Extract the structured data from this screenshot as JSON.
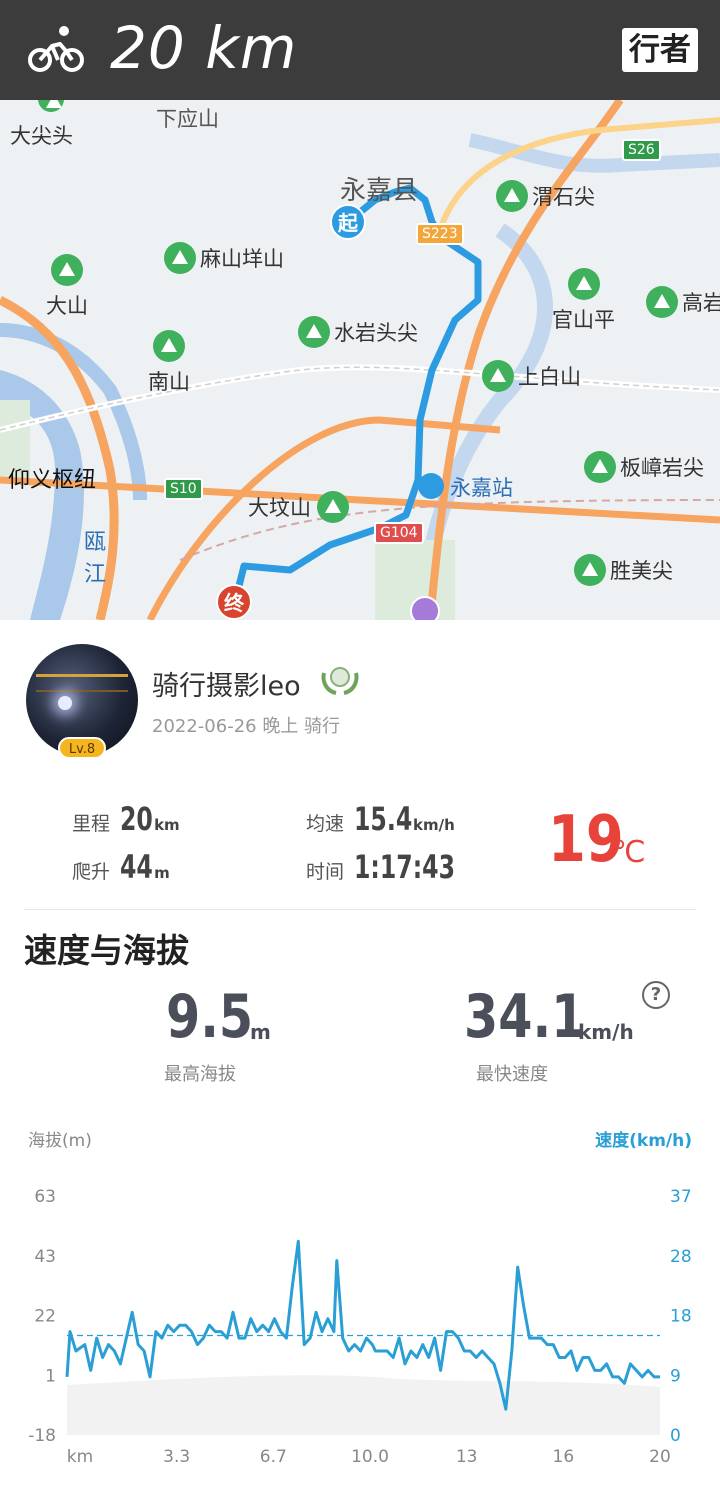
{
  "header": {
    "distance": "20 km",
    "brand": "行者"
  },
  "map": {
    "pois": [
      "大尖头",
      "麻山垟山",
      "大山",
      "水岩头尖",
      "南山",
      "大坟山",
      "渭石尖",
      "官山平",
      "高岩",
      "上白山",
      "板嶂岩尖",
      "胜美尖"
    ],
    "labels": [
      "下应山",
      "永嘉县",
      "仰义枢纽",
      "瓯",
      "江",
      "永嘉站"
    ],
    "roads": [
      "S26",
      "S223",
      "S10",
      "G104"
    ],
    "start_label": "起",
    "end_label": "终"
  },
  "profile": {
    "username": "骑行摄影leo",
    "level": "Lv.8",
    "date": "2022-06-26 晚上 骑行"
  },
  "stats": {
    "distance_label": "里程",
    "distance_value": "20",
    "distance_unit": "km",
    "climb_label": "爬升",
    "climb_value": "44",
    "climb_unit": "m",
    "avg_label": "均速",
    "avg_value": "15.4",
    "avg_unit": "km/h",
    "time_label": "时间",
    "time_value": "1:17:43",
    "temp_value": "19",
    "temp_unit": "℃"
  },
  "section": {
    "title": "速度与海拔",
    "max_alt_value": "9.5",
    "max_alt_unit": "m",
    "max_alt_label": "最高海拔",
    "max_speed_value": "34.1",
    "max_speed_unit": "km/h",
    "max_speed_label": "最快速度",
    "help": "?"
  },
  "colors": {
    "speed_line": "#2a9fd6",
    "route": "#2c9be2",
    "temp": "#e8433a",
    "poi": "#3fb05c"
  },
  "chart_data": {
    "type": "line",
    "left_axis_title": "海拔(m)",
    "right_axis_title": "速度(km/h)",
    "xlabel": "km",
    "x_ticks": [
      "km",
      "3.3",
      "6.7",
      "10.0",
      "13",
      "16",
      "20"
    ],
    "left_ticks": [
      "63",
      "43",
      "22",
      "1",
      "-18"
    ],
    "right_ticks": [
      "37",
      "28",
      "18",
      "9",
      "0"
    ],
    "xlim": [
      0,
      20
    ],
    "speed_ylim": [
      0,
      37
    ],
    "avg_speed": 15.4,
    "series": [
      {
        "axis": "right",
        "x": [
          0.0,
          0.1,
          0.3,
          0.6,
          0.8,
          1.0,
          1.2,
          1.4,
          1.6,
          1.8,
          2.0,
          2.2,
          2.4,
          2.6,
          2.8,
          3.0,
          3.2,
          3.4,
          3.6,
          3.8,
          4.0,
          4.2,
          4.4,
          4.6,
          4.8,
          5.0,
          5.2,
          5.4,
          5.6,
          5.8,
          6.0,
          6.2,
          6.4,
          6.6,
          6.8,
          7.0,
          7.2,
          7.4,
          7.6,
          7.8,
          8.0,
          8.2,
          8.4,
          8.6,
          8.8,
          9.0,
          9.1,
          9.3,
          9.5,
          9.7,
          9.9,
          10.1,
          10.3,
          10.4,
          10.6,
          10.8,
          11.0,
          11.2,
          11.4,
          11.6,
          11.8,
          12.0,
          12.2,
          12.4,
          12.6,
          12.8,
          13.0,
          13.2,
          13.4,
          13.6,
          13.8,
          14.0,
          14.2,
          14.4,
          14.6,
          14.8,
          15.0,
          15.2,
          15.4,
          15.6,
          15.8,
          16.0,
          16.2,
          16.4,
          16.6,
          16.8,
          17.0,
          17.2,
          17.4,
          17.6,
          17.8,
          18.0,
          18.2,
          18.4,
          18.6,
          18.8,
          19.0,
          19.2,
          19.4,
          19.6,
          19.8,
          20.0
        ],
        "values": [
          9,
          16,
          13,
          14,
          10,
          15,
          12,
          14,
          13,
          11,
          15,
          19,
          14,
          13,
          9,
          16,
          15,
          17,
          16,
          17,
          17,
          16,
          14,
          15,
          17,
          16,
          16,
          15,
          19,
          15,
          15,
          18,
          16,
          17,
          16,
          18,
          16,
          15,
          23,
          30,
          14,
          15,
          19,
          16,
          18,
          16,
          27,
          15,
          13,
          14,
          13,
          15,
          14,
          13,
          13,
          13,
          12,
          15,
          11,
          13,
          12,
          14,
          12,
          15,
          10,
          16,
          16,
          15,
          13,
          13,
          12,
          13,
          12,
          11,
          8,
          4,
          13,
          26,
          20,
          15,
          15,
          15,
          14,
          14,
          12,
          12,
          13,
          10,
          12,
          12,
          10,
          10,
          11,
          9,
          9,
          8,
          11,
          10,
          9,
          10,
          9,
          9
        ]
      }
    ]
  }
}
